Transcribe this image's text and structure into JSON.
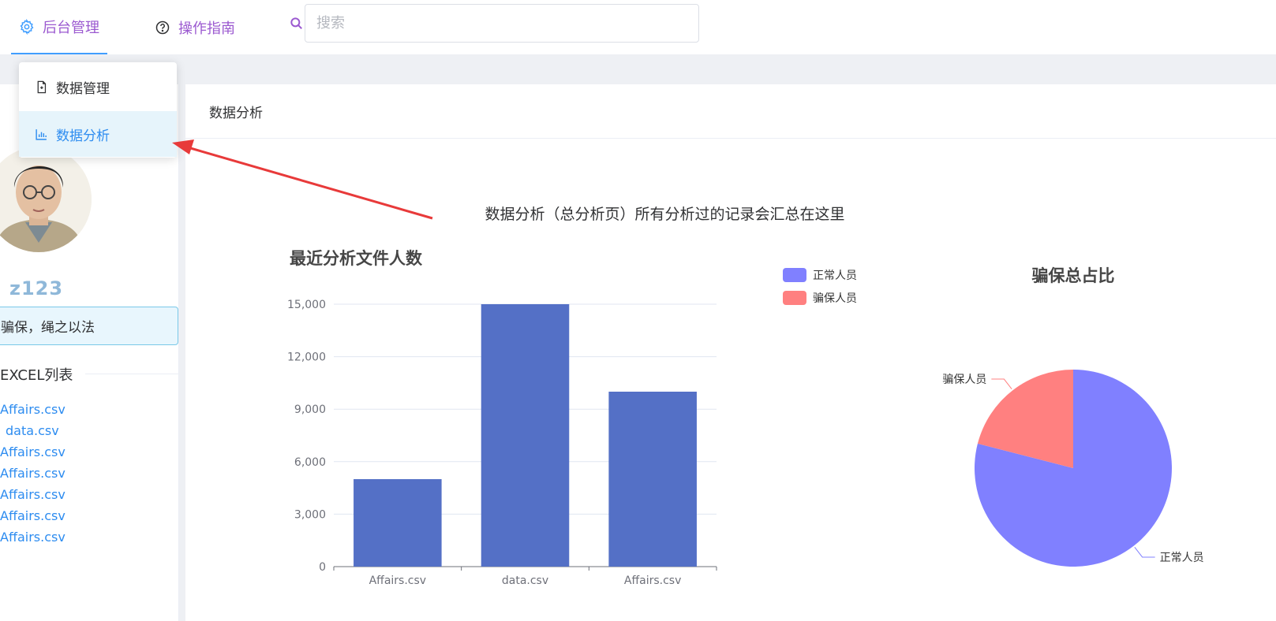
{
  "nav": {
    "admin_label": "后台管理",
    "guide_label": "操作指南",
    "search_placeholder": "搜索"
  },
  "menu": {
    "items": [
      {
        "label": "数据管理"
      },
      {
        "label": "数据分析"
      }
    ]
  },
  "profile": {
    "username": "z123",
    "motto": "骗保，绳之以法",
    "excel_title": "EXCEL列表",
    "files": [
      "Affairs.csv",
      "data.csv",
      "Affairs.csv",
      "Affairs.csv",
      "Affairs.csv",
      "Affairs.csv",
      "Affairs.csv"
    ]
  },
  "main": {
    "breadcrumb": "数据分析",
    "heading": "数据分析（总分析页）所有分析过的记录会汇总在这里"
  },
  "colors": {
    "accent": "#409eff",
    "nav_text": "#9b59d0",
    "bar": "#5470c6",
    "normal": "#8080ff",
    "fraud": "#ff8080",
    "arrow": "#e83a3a"
  },
  "chart_data": [
    {
      "type": "bar",
      "title": "最近分析文件人数",
      "categories": [
        "Affairs.csv",
        "data.csv",
        "Affairs.csv"
      ],
      "values": [
        5000,
        15000,
        10000
      ],
      "ylim": [
        0,
        15000
      ],
      "yticks": [
        "0",
        "3,000",
        "6,000",
        "9,000",
        "12,000",
        "15,000"
      ],
      "grid": true
    },
    {
      "type": "pie",
      "title": "骗保总占比",
      "legend_position": "top-left",
      "slices": [
        {
          "name": "正常人员",
          "value": 79
        },
        {
          "name": "骗保人员",
          "value": 21
        }
      ]
    }
  ]
}
